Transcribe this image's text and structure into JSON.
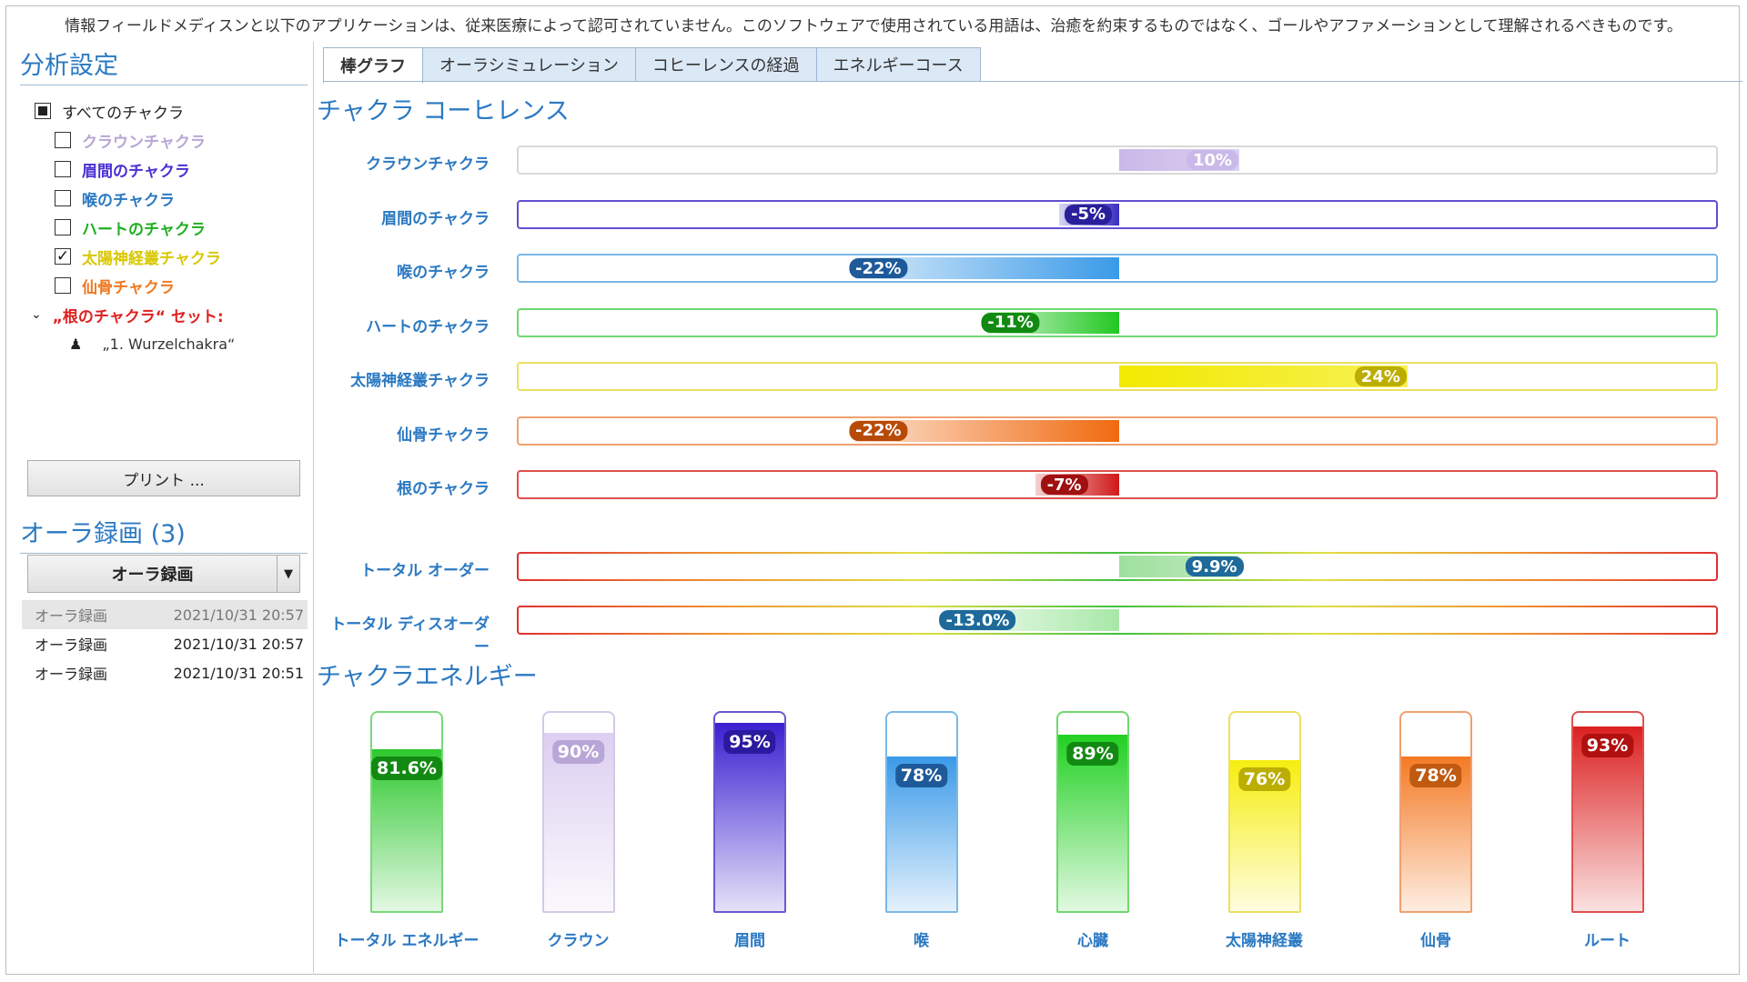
{
  "disclaimer": "情報フィールドメディスンと以下のアプリケーションは、従来医療によって認可されていません。このソフトウェアで使用されている用語は、治癒を約束するものではなく、ゴールやアファメーションとして理解されるべきものです。",
  "analysis": {
    "title": "分析設定",
    "all_label": "すべてのチャクラ",
    "items": [
      {
        "label": "クラウンチャクラ",
        "checked": false,
        "color": "#b9a6d6"
      },
      {
        "label": "眉間のチャクラ",
        "checked": false,
        "color": "#4a2fd6"
      },
      {
        "label": "喉のチャクラ",
        "checked": false,
        "color": "#2b79c2"
      },
      {
        "label": "ハートのチャクラ",
        "checked": false,
        "color": "#20b020"
      },
      {
        "label": "太陽神経叢チャクラ",
        "checked": true,
        "color": "#d8c800"
      },
      {
        "label": "仙骨チャクラ",
        "checked": false,
        "color": "#f07820"
      }
    ],
    "set_label": "„根のチャクラ“ セット:",
    "set_child": "„1. Wurzelchakra“",
    "set_color": "#e02020"
  },
  "print_label": "プリント ...",
  "recordings": {
    "title": "オーラ録画 (3)",
    "selected": "オーラ録画",
    "list": [
      {
        "name": "オーラ録画",
        "date": "2021/10/31 20:57"
      },
      {
        "name": "オーラ録画",
        "date": "2021/10/31 20:57"
      },
      {
        "name": "オーラ録画",
        "date": "2021/10/31 20:51"
      }
    ]
  },
  "tabs": [
    "棒グラフ",
    "オーラシミュレーション",
    "コヒーレンスの経過",
    "エネルギーコース"
  ],
  "coherence": {
    "title": "チャクラ コーヒレンス",
    "bars": [
      {
        "label": "クラウンチャクラ",
        "value": 10,
        "text": "10%",
        "color": "#c9b8e8",
        "badge": "#c9b8e8",
        "border": "#d8d8d8"
      },
      {
        "label": "眉間のチャクラ",
        "value": -5,
        "text": "-5%",
        "color": "#3a2fc0",
        "badge": "#2a1f9a",
        "border": "#6050d0"
      },
      {
        "label": "喉のチャクラ",
        "value": -22,
        "text": "-22%",
        "color": "#3a9ae8",
        "badge": "#1e5a9a",
        "border": "#7ab8e8"
      },
      {
        "label": "ハートのチャクラ",
        "value": -11,
        "text": "-11%",
        "color": "#22c822",
        "badge": "#128a12",
        "border": "#70d870"
      },
      {
        "label": "太陽神経叢チャクラ",
        "value": 24,
        "text": "24%",
        "color": "#f2ea00",
        "badge": "#bcae00",
        "border": "#ece060"
      },
      {
        "label": "仙骨チャクラ",
        "value": -22,
        "text": "-22%",
        "color": "#f06a10",
        "badge": "#b84a08",
        "border": "#f0a070"
      },
      {
        "label": "根のチャクラ",
        "value": -7,
        "text": "-7%",
        "color": "#d01818",
        "badge": "#a01010",
        "border": "#e05050"
      }
    ],
    "totals": [
      {
        "label": "トータル オーダー",
        "value": 9.9,
        "text": "9.9%",
        "color": "#9ee09e",
        "badge": "#1e6a9a"
      },
      {
        "label": "トータル ディスオーダー",
        "value": -13.0,
        "text": "-13.0%",
        "color": "#a8e8a8",
        "badge": "#1e6a9a"
      }
    ]
  },
  "energy": {
    "title": "チャクラエネルギー",
    "columns": [
      {
        "label": "トータル エネルギー",
        "value": 81.6,
        "text": "81.6%",
        "color": "#2ec82e",
        "badge": "#128a12",
        "border": "#7ad87a"
      },
      {
        "label": "クラウン",
        "value": 90,
        "text": "90%",
        "color": "#dccff0",
        "badge": "#b8a6d6",
        "border": "#d4c8e8"
      },
      {
        "label": "眉間",
        "value": 95,
        "text": "95%",
        "color": "#3a20d0",
        "badge": "#2a1aa0",
        "border": "#6a58d0"
      },
      {
        "label": "喉",
        "value": 78,
        "text": "78%",
        "color": "#3a9ae8",
        "badge": "#1e5a9a",
        "border": "#7ab8e8"
      },
      {
        "label": "心臓",
        "value": 89,
        "text": "89%",
        "color": "#22d022",
        "badge": "#128a12",
        "border": "#70d870"
      },
      {
        "label": "太陽神経叢",
        "value": 76,
        "text": "76%",
        "color": "#f6ee10",
        "badge": "#bcae00",
        "border": "#ece060"
      },
      {
        "label": "仙骨",
        "value": 78,
        "text": "78%",
        "color": "#f47a24",
        "badge": "#c05a10",
        "border": "#f0a070"
      },
      {
        "label": "ルート",
        "value": 93,
        "text": "93%",
        "color": "#dc2020",
        "badge": "#b01010",
        "border": "#e05050"
      }
    ]
  }
}
